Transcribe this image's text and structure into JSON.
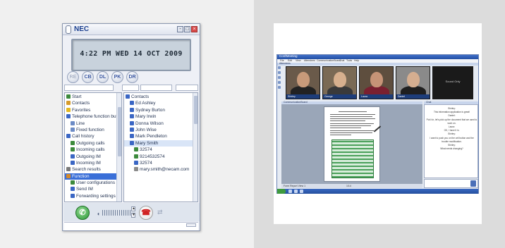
{
  "phone": {
    "brand": "NEC",
    "display": "4:22 PM WED 14 OCT 2009",
    "title_buttons": {
      "minimize": "-",
      "maximize": "□",
      "close": "×"
    },
    "function_buttons": [
      "RE",
      "CB",
      "DL",
      "PK",
      "DR"
    ],
    "call_button_icon": "phone-icon",
    "hangup_button_icon": "hangup-icon",
    "left_tree": [
      {
        "label": "Start",
        "icon": "start-icon",
        "color": "#3c8a3c",
        "indent": 0
      },
      {
        "label": "Contacts",
        "icon": "contacts-icon",
        "color": "#d59a2a",
        "indent": 0
      },
      {
        "label": "Favorites",
        "icon": "star-icon",
        "color": "#e3b820",
        "indent": 0
      },
      {
        "label": "Telephone function butto",
        "icon": "phone-icon",
        "color": "#3a66c4",
        "indent": 0
      },
      {
        "label": "Line",
        "icon": "line-icon",
        "color": "#6c8bc6",
        "indent": 1
      },
      {
        "label": "Fixed function",
        "icon": "fixed-function-icon",
        "color": "#6c8bc6",
        "indent": 1
      },
      {
        "label": "Call history",
        "icon": "history-icon",
        "color": "#3a66c4",
        "indent": 0
      },
      {
        "label": "Outgoing calls",
        "icon": "outgoing-call-icon",
        "color": "#3c8a3c",
        "indent": 1
      },
      {
        "label": "Incoming calls",
        "icon": "incoming-call-icon",
        "color": "#3c8a3c",
        "indent": 1
      },
      {
        "label": "Outgoing IM",
        "icon": "outgoing-im-icon",
        "color": "#3a66c4",
        "indent": 1
      },
      {
        "label": "Incoming IM",
        "icon": "incoming-im-icon",
        "color": "#3a66c4",
        "indent": 1
      },
      {
        "label": "Search results",
        "icon": "search-icon",
        "color": "#7a7a7a",
        "indent": 0
      },
      {
        "label": "Function",
        "icon": "function-icon",
        "color": "#d58a2a",
        "indent": 0,
        "selected": true
      },
      {
        "label": "User configurations",
        "icon": "user-config-icon",
        "color": "#3c8a3c",
        "indent": 1
      },
      {
        "label": "Send IM",
        "icon": "send-im-icon",
        "color": "#3a66c4",
        "indent": 1
      },
      {
        "label": "Forwarding settings",
        "icon": "forwarding-icon",
        "color": "#3a66c4",
        "indent": 1
      }
    ],
    "right_tree": [
      {
        "label": "Contacts",
        "icon": "contacts-icon",
        "color": "#3a66c4",
        "indent": 0
      },
      {
        "label": "Ed Ashley",
        "icon": "person-icon",
        "color": "#3a66c4",
        "indent": 1
      },
      {
        "label": "Sydney Burton",
        "icon": "person-icon",
        "color": "#3a66c4",
        "indent": 1
      },
      {
        "label": "Mary Irwin",
        "icon": "person-icon",
        "color": "#3a66c4",
        "indent": 1
      },
      {
        "label": "Donna Wilson",
        "icon": "person-icon",
        "color": "#3a66c4",
        "indent": 1
      },
      {
        "label": "John Wise",
        "icon": "person-icon",
        "color": "#3a66c4",
        "indent": 1
      },
      {
        "label": "Mark Pendleton",
        "icon": "person-icon",
        "color": "#3a66c4",
        "indent": 1
      },
      {
        "label": "Mary Smith",
        "icon": "person-icon",
        "color": "#3a66c4",
        "indent": 1,
        "highlighted": true
      },
      {
        "label": "32574",
        "icon": "phone-icon",
        "color": "#3c8a3c",
        "indent": 2
      },
      {
        "label": "9214532574",
        "icon": "mobile-icon",
        "color": "#3c8a3c",
        "indent": 2
      },
      {
        "label": "32574",
        "icon": "im-icon",
        "color": "#3a66c4",
        "indent": 2
      },
      {
        "label": "mary.smith@necam.com",
        "icon": "email-icon",
        "color": "#8a8a8a",
        "indent": 2
      }
    ]
  },
  "conference": {
    "title": "ConfMeeting",
    "menus": [
      "File",
      "Edit",
      "View",
      "Attendees",
      "CommunicationBoard",
      "Chat",
      "Tools",
      "Help"
    ],
    "participants_label": "Attendees",
    "tiles": [
      {
        "caption": "Shirley",
        "skin": "#c89a7a",
        "shirt": "#222222",
        "bg": "#6a5a4a"
      },
      {
        "caption": "George",
        "skin": "#d7b08e",
        "shirt": "#3a3a3a",
        "bg": "#7a6a55"
      },
      {
        "caption": "Laura",
        "skin": "#c79477",
        "shirt": "#7a2030",
        "bg": "#5e4e3e"
      },
      {
        "caption": "Daniel",
        "skin": "#d5ae90",
        "shirt": "#1f1f1f",
        "bg": "#8a8a8a"
      }
    ],
    "sound_only_label": "Sound Only",
    "whiteboard_label": "CommunicationBoard",
    "chat_label": "Chat",
    "chat_lines": [
      "Shirley:",
      "This information application is great!",
      "Daniel:",
      "Put it in, let's pick up the document that we used to",
      "work on.",
      "Laura:",
      "OK, I have it in.",
      "Shirley:",
      "I want to push you on the cell button and the",
      "trouble modification.",
      "Shirley:",
      "What needs changing?"
    ],
    "board_status": "Form Report  View 1",
    "page_indicator": "1/14"
  }
}
